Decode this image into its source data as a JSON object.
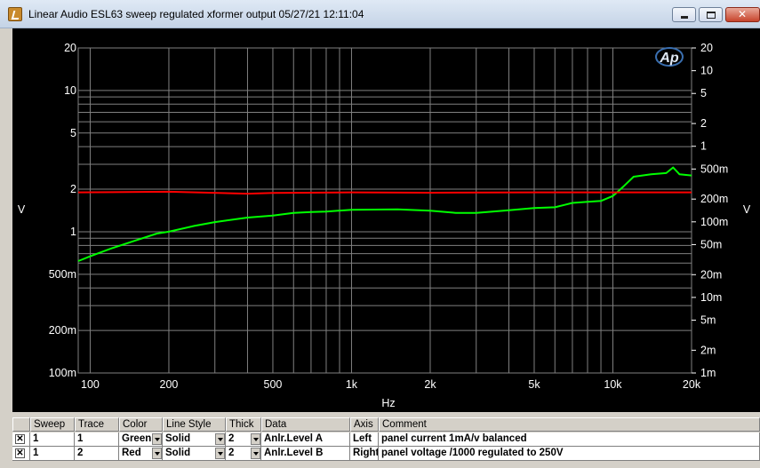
{
  "window": {
    "title": "Linear Audio  ESL63 sweep regulated xformer output  05/27/21 12:11:04",
    "controls": [
      "minimize",
      "maximize",
      "close"
    ]
  },
  "colors": {
    "background": "#000000",
    "grid": "#808080",
    "text": "#ffffff",
    "series1": "#00ff00",
    "series2": "#ff0000"
  },
  "chart_data": {
    "type": "line",
    "xscale": "log",
    "yscale": "log",
    "xlabel": "Hz",
    "ylabel": "V",
    "y2label": "V",
    "xlim": [
      90,
      20000
    ],
    "ylim": [
      0.1,
      20
    ],
    "y2lim": [
      0.001,
      20
    ],
    "grid": true,
    "xticks": [
      100,
      200,
      500,
      1000,
      2000,
      5000,
      10000,
      20000
    ],
    "xtick_labels": [
      "100",
      "200",
      "500",
      "1k",
      "2k",
      "5k",
      "10k",
      "20k"
    ],
    "yticks": [
      20,
      10,
      5,
      2,
      1,
      0.5,
      0.2,
      0.1
    ],
    "ytick_labels": [
      "20",
      "10",
      "5",
      "2",
      "1",
      "500m",
      "200m",
      "100m"
    ],
    "y2ticks": [
      20,
      10,
      5,
      2,
      1,
      0.5,
      0.2,
      0.1,
      0.05,
      0.02,
      0.01,
      0.005,
      0.002,
      0.001
    ],
    "y2tick_labels": [
      "20",
      "10",
      "5",
      "2",
      "1",
      "500m",
      "200m",
      "100m",
      "50m",
      "20m",
      "10m",
      "5m",
      "2m",
      "1m"
    ],
    "series": [
      {
        "color": "#00ff00",
        "axis": "left",
        "x": [
          90,
          100,
          120,
          150,
          180,
          200,
          250,
          300,
          400,
          500,
          600,
          700,
          800,
          1000,
          1500,
          2000,
          2500,
          3000,
          4000,
          5000,
          6000,
          7000,
          8000,
          9000,
          10000,
          11000,
          12000,
          14000,
          16000,
          17000,
          18000,
          20000
        ],
        "y": [
          0.62,
          0.67,
          0.76,
          0.87,
          0.97,
          1.0,
          1.1,
          1.17,
          1.26,
          1.3,
          1.36,
          1.38,
          1.39,
          1.43,
          1.44,
          1.41,
          1.36,
          1.36,
          1.42,
          1.47,
          1.49,
          1.6,
          1.63,
          1.65,
          1.79,
          2.1,
          2.45,
          2.55,
          2.6,
          2.85,
          2.55,
          2.5
        ]
      },
      {
        "color": "#ff0000",
        "axis": "left",
        "x": [
          90,
          200,
          400,
          500,
          1000,
          2000,
          5000,
          10000,
          20000
        ],
        "y": [
          1.9,
          1.92,
          1.86,
          1.88,
          1.9,
          1.89,
          1.9,
          1.9,
          1.9
        ]
      }
    ]
  },
  "legend": {
    "headers": [
      "Sweep",
      "Trace",
      "Color",
      "Line Style",
      "Thick",
      "Data",
      "Axis",
      "Comment"
    ],
    "rows": [
      {
        "checked": "✕",
        "sweep": "1",
        "trace": "1",
        "color": "Green",
        "style": "Solid",
        "thick": "2",
        "data": "Anlr.Level A",
        "axis": "Left",
        "comment": "panel current 1mA/v balanced"
      },
      {
        "checked": "✕",
        "sweep": "1",
        "trace": "2",
        "color": "Red",
        "style": "Solid",
        "thick": "2",
        "data": "Anlr.Level B",
        "axis": "Right",
        "comment": "panel voltage /1000 regulated to 250V"
      }
    ]
  },
  "logo": {
    "text": "Ap"
  }
}
